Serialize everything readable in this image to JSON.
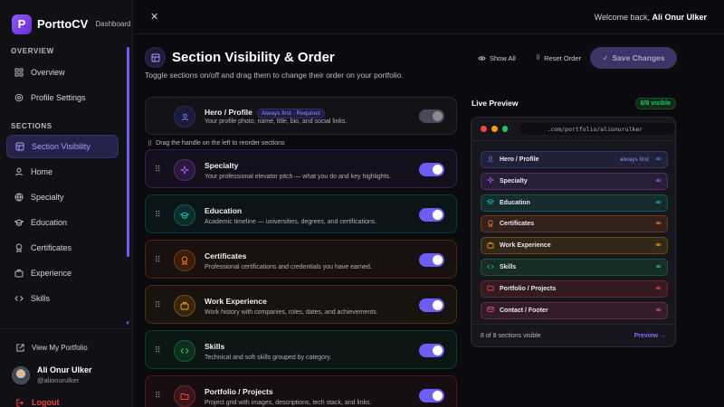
{
  "brand": {
    "logo": "P",
    "name": "PorttoCV",
    "sub": "Dashboard"
  },
  "sidebar": {
    "overview_label": "OVERVIEW",
    "overview": [
      {
        "label": "Overview",
        "icon": "grid-icon"
      },
      {
        "label": "Profile Settings",
        "icon": "settings-icon"
      }
    ],
    "sections_label": "SECTIONS",
    "sections": [
      {
        "label": "Section Visibility",
        "icon": "layout-icon",
        "active": true
      },
      {
        "label": "Home",
        "icon": "user-icon"
      },
      {
        "label": "Specialty",
        "icon": "globe-icon"
      },
      {
        "label": "Education",
        "icon": "graduation-icon"
      },
      {
        "label": "Certificates",
        "icon": "award-icon"
      },
      {
        "label": "Experience",
        "icon": "briefcase-icon"
      },
      {
        "label": "Skills",
        "icon": "code-icon"
      }
    ],
    "view_portfolio": "View My Portfolio",
    "user": {
      "name": "Ali Onur Ulker",
      "handle": "@alionurulker"
    },
    "logout": "Logout"
  },
  "topbar": {
    "close": "✕",
    "welcome_prefix": "Welcome back,",
    "welcome_name": "Ali Onur Ulker"
  },
  "page": {
    "title": "Section Visibility & Order",
    "subtitle": "Toggle sections on/off and drag them to change their order on your portfolio.",
    "show_all": "Show All",
    "reset_order": "Reset Order",
    "save": "Save Changes",
    "drag_hint": "Drag the handle on the left to reorder sections"
  },
  "hero": {
    "title": "Hero / Profile",
    "badge": "Always first · Required",
    "desc": "Your profile photo, name, title, bio, and social links."
  },
  "cards": [
    {
      "title": "Specialty",
      "desc": "Your professional elevator pitch — what you do and key highlights.",
      "color": "#a855f7",
      "icon": "sparkle-icon",
      "on": true
    },
    {
      "title": "Education",
      "desc": "Academic timeline — universities, degrees, and certifications.",
      "color": "#14b8a6",
      "icon": "graduation-icon",
      "on": true
    },
    {
      "title": "Certificates",
      "desc": "Professional certifications and credentials you have earned.",
      "color": "#f97316",
      "icon": "award-icon",
      "on": true
    },
    {
      "title": "Work Experience",
      "desc": "Work history with companies, roles, dates, and achievements.",
      "color": "#f59e0b",
      "icon": "briefcase-icon",
      "on": true
    },
    {
      "title": "Skills",
      "desc": "Technical and soft skills grouped by category.",
      "color": "#22c55e",
      "icon": "code-icon",
      "on": true
    },
    {
      "title": "Portfolio / Projects",
      "desc": "Project grid with images, descriptions, tech stack, and links.",
      "color": "#ef4444",
      "icon": "folder-icon",
      "on": true
    }
  ],
  "preview": {
    "title": "Live Preview",
    "count": "8/8 visible",
    "url": ".com/portfolio/alionurulker",
    "always_first": "always first",
    "rows": [
      {
        "label": "Hero / Profile",
        "color": "#6366f1"
      },
      {
        "label": "Specialty",
        "color": "#a855f7"
      },
      {
        "label": "Education",
        "color": "#14b8a6"
      },
      {
        "label": "Certificates",
        "color": "#f97316"
      },
      {
        "label": "Work Experience",
        "color": "#f59e0b"
      },
      {
        "label": "Skills",
        "color": "#22c55e"
      },
      {
        "label": "Portfolio / Projects",
        "color": "#ef4444"
      },
      {
        "label": "Contact / Footer",
        "color": "#ec4899"
      }
    ],
    "footer_left": "8 of 8 sections visible",
    "footer_right": "Preview →"
  }
}
